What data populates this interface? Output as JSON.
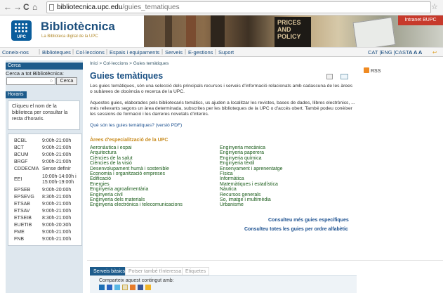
{
  "browser": {
    "url_host": "bibliotecnica.upc.edu",
    "url_path": "/guies_tematiques",
    "back": "←",
    "forward": "→",
    "reload": "C",
    "home": "⌂",
    "star": "☆"
  },
  "header": {
    "site_name": "Bibliotècnica",
    "site_subtitle": "La Biblioteca digital de la UPC",
    "logo_text": "UPC",
    "banner_book_title": "PRICES\nAND\nPOLICY",
    "intranet": "Intranet BUPC"
  },
  "nav": {
    "items": [
      "Coneix-nos",
      "Biblioteques",
      "Col·leccions",
      "Espais i equipaments",
      "Serveis",
      "E-gestions",
      "Suport"
    ],
    "languages": "CAT |ENG |CAST",
    "font_sizes": "A  A  A"
  },
  "sidebar": {
    "search_heading": "Cerca",
    "search_label": "Cerca a tot Bibliotècnica:",
    "search_button": "Cerca",
    "hours_heading": "Horaris",
    "hours_intro": "Cliqueu el nom de la biblioteca per consultar la resta d'horaris.",
    "hours": [
      {
        "lib": "BCBL",
        "time": "9:00h-21:00h"
      },
      {
        "lib": "BCT",
        "time": "9:00h-21:00h"
      },
      {
        "lib": "BCUM",
        "time": "9:00h-21:00h"
      },
      {
        "lib": "BRGF",
        "time": "9:00h-21:00h"
      },
      {
        "lib": "CDDECMA",
        "time": "Sense definir"
      },
      {
        "lib": "EEI",
        "time": "10:00h-14:00h i 15:00h-19:00h"
      },
      {
        "lib": "EPSEB",
        "time": "9:00h-20:00h"
      },
      {
        "lib": "EPSEVG",
        "time": "8:30h-21:00h"
      },
      {
        "lib": "ETSAB",
        "time": "9:00h-21:00h"
      },
      {
        "lib": "ETSAV",
        "time": "9:00h-21:00h"
      },
      {
        "lib": "ETSEIB",
        "time": "8:30h-21:00h"
      },
      {
        "lib": "EUETIB",
        "time": "9:00h-20:30h"
      },
      {
        "lib": "FME",
        "time": "9:00h-21:00h"
      },
      {
        "lib": "FNB",
        "time": "9:00h-21:00h"
      }
    ]
  },
  "main": {
    "breadcrumb": "Inici > Col·leccions > Guies temàtiques",
    "title": "Guies temàtiques",
    "rss": "RSS",
    "para1": "Les guies temàtiques,  són una selecció dels principals recursos i serveis d'informació relacionats amb cadascuna de les àrees o subàrees de docència o recerca de la UPC.",
    "para2": "Aquestes guies, elaborades pels bibliotecaris temàtics,  us ajuden a localitzar les revistes, bases de dades, llibres electrònics, ... més rellevants segons un àrea determinada, subscrites per les biblioteques de la UPC o d'accés obert. També podeu conèixer les sessions de formació i les darreres novetats d'interès.",
    "what_link": "Què són les guies temàtiques? (versió PDF)",
    "section_heading": "Àrees d'especialització de la UPC",
    "col1": [
      "Aeronàutica i espai",
      "Arquitectura",
      "Ciències de la salut",
      "Ciències de la visió",
      "Desenvolupament humà i sostenible",
      "Economia i organització empreses",
      "Edificació",
      "Energies",
      "Enginyeria agroalimentària",
      "Enginyeria civil",
      "Enginyeria dels materials",
      "Enginyeria electrònica i telecomunicacions"
    ],
    "col2": [
      "Enginyeria mecànica",
      "Enginyeria paperera",
      "Enginyeria química",
      "Enginyeria tèxtil",
      "Ensenyament i aprenentatge",
      "Física",
      "Informàtica",
      "Matemàtiques i estadística",
      "Nàutica",
      "Recursos generals",
      "So, imatge i multimèdia",
      "Urbanisme"
    ],
    "more1": "Consulteu més guies específiques",
    "more2": "Consulteu totes les guies per ordre alfabètic",
    "tabs": [
      "Serveis bàsics",
      "Potser també t'interessa",
      "Etiquetes"
    ],
    "share_label": "Comparteix aquest contingut amb:"
  },
  "colors": {
    "brand_blue": "#1d5b8b",
    "link_green": "#1a5c1a",
    "section_orange": "#c88b1e",
    "intranet_red": "#c7392b"
  }
}
